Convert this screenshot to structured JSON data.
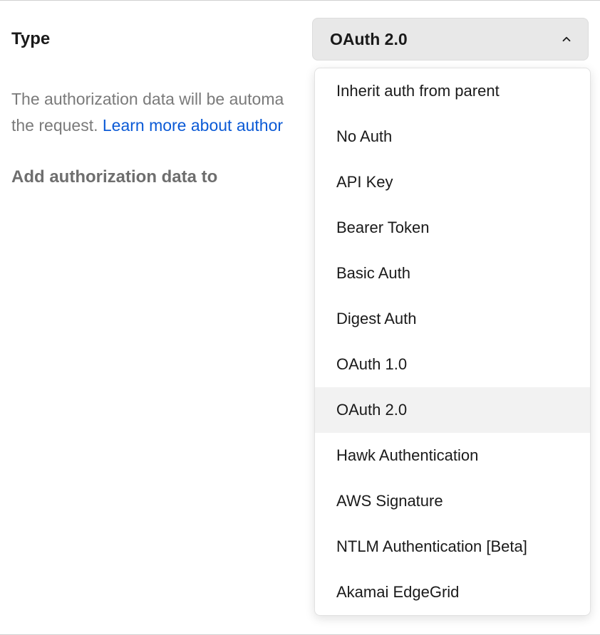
{
  "labels": {
    "type": "Type",
    "addDataTo": "Add authorization data to"
  },
  "select": {
    "value": "OAuth 2.0"
  },
  "description": {
    "prefix": "The authorization data will be automa",
    "line2Prefix": "the request. ",
    "linkText": "Learn more about author"
  },
  "dropdown": {
    "options": [
      {
        "label": "Inherit auth from parent",
        "selected": false
      },
      {
        "label": "No Auth",
        "selected": false
      },
      {
        "label": "API Key",
        "selected": false
      },
      {
        "label": "Bearer Token",
        "selected": false
      },
      {
        "label": "Basic Auth",
        "selected": false
      },
      {
        "label": "Digest Auth",
        "selected": false
      },
      {
        "label": "OAuth 1.0",
        "selected": false
      },
      {
        "label": "OAuth 2.0",
        "selected": true
      },
      {
        "label": "Hawk Authentication",
        "selected": false
      },
      {
        "label": "AWS Signature",
        "selected": false
      },
      {
        "label": "NTLM Authentication [Beta]",
        "selected": false
      },
      {
        "label": "Akamai EdgeGrid",
        "selected": false
      }
    ]
  }
}
